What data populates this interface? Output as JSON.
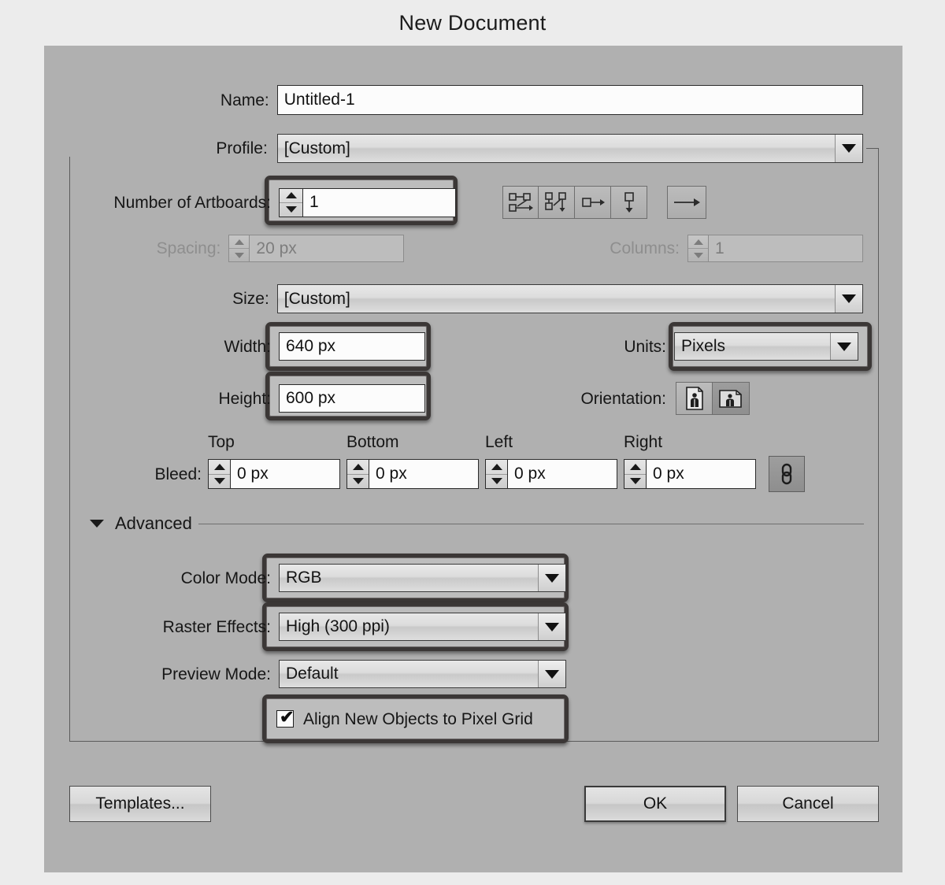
{
  "window": {
    "title": "New Document"
  },
  "fields": {
    "name": {
      "label": "Name:",
      "value": "Untitled-1"
    },
    "profile": {
      "label": "Profile:",
      "value": "[Custom]"
    },
    "artboards": {
      "label": "Number of Artboards:",
      "value": "1"
    },
    "spacing": {
      "label": "Spacing:",
      "value": "20 px"
    },
    "columns": {
      "label": "Columns:",
      "value": "1"
    },
    "size": {
      "label": "Size:",
      "value": "[Custom]"
    },
    "width": {
      "label": "Width:",
      "value": "640 px"
    },
    "height": {
      "label": "Height:",
      "value": "600 px"
    },
    "units": {
      "label": "Units:",
      "value": "Pixels"
    },
    "orientation": {
      "label": "Orientation:",
      "portrait_icon": "portrait-orientation-icon",
      "landscape_icon": "landscape-orientation-icon",
      "selected": "landscape"
    },
    "bleed": {
      "label": "Bleed:",
      "top_label": "Top",
      "bottom_label": "Bottom",
      "left_label": "Left",
      "right_label": "Right",
      "top": "0 px",
      "bottom": "0 px",
      "left": "0 px",
      "right": "0 px",
      "link_icon": "chain-link-icon"
    },
    "advanced": {
      "label": "Advanced",
      "caret_icon": "caret-down-icon"
    },
    "color_mode": {
      "label": "Color Mode:",
      "value": "RGB"
    },
    "raster_effects": {
      "label": "Raster Effects:",
      "value": "High (300 ppi)"
    },
    "preview_mode": {
      "label": "Preview Mode:",
      "value": "Default"
    },
    "align_pixel_grid": {
      "label": "Align New Objects to Pixel Grid",
      "checked": "✔"
    }
  },
  "artboard_layout_buttons": [
    {
      "name": "grid-by-row-icon",
      "title": "Grid by Row"
    },
    {
      "name": "grid-by-column-icon",
      "title": "Grid by Column"
    },
    {
      "name": "arrange-by-row-icon",
      "title": "Arrange by Row"
    },
    {
      "name": "arrange-by-column-icon",
      "title": "Arrange by Column"
    }
  ],
  "rtl_button": {
    "name": "change-to-rtl-layout-icon"
  },
  "buttons": {
    "templates": "Templates...",
    "ok": "OK",
    "cancel": "Cancel"
  },
  "colors": {
    "dialog_bg": "#b0b0b0",
    "window_bg": "#ececec",
    "highlight_ring": "#3b3736",
    "input_bg": "#fcfcfc",
    "text": "#161616",
    "disabled_text": "#8e8e8e"
  }
}
